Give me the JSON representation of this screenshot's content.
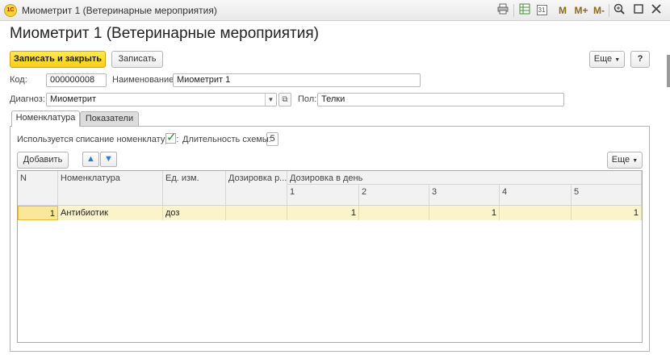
{
  "window": {
    "app_logo": "1С",
    "title": "Миометрит 1 (Ветеринарные мероприятия)",
    "toolbar_icons": [
      "print-icon",
      "spreadsheet-icon",
      "calendar-icon",
      "memory-store-icon",
      "memory-add-icon",
      "memory-subtract-icon",
      "zoom-icon",
      "maximize-icon",
      "close-icon"
    ],
    "calendar_glyph": "31",
    "mem_labels": [
      "M",
      "M+",
      "M-"
    ]
  },
  "header": {
    "title": "Миометрит 1 (Ветеринарные мероприятия)"
  },
  "commandbar": {
    "save_close_label": "Записать и закрыть",
    "save_label": "Записать",
    "more_label": "Еще",
    "help_label": "?"
  },
  "form": {
    "code_label": "Код:",
    "code_value": "000000008",
    "name_label": "Наименование:",
    "name_value": "Миометрит 1",
    "diagnosis_label": "Диагноз:",
    "diagnosis_value": "Миометрит",
    "sex_label": "Пол:",
    "sex_value": "Телки"
  },
  "tabs": [
    {
      "label": "Номенклатура",
      "active": true
    },
    {
      "label": "Показатели",
      "active": false
    }
  ],
  "nomenclature": {
    "uses_writeoff_label": "Используется списание номенклатуры:",
    "uses_writeoff_checked": true,
    "duration_label": "Длительность схемы:",
    "duration_value": "5",
    "add_label": "Добавить",
    "more_label": "Еще"
  },
  "table": {
    "headers": {
      "n": "N",
      "item": "Номенклатура",
      "unit": "Ед. изм.",
      "dosage": "Дозировка р...",
      "per_day": "Дозировка в день",
      "days": [
        "1",
        "2",
        "3",
        "4",
        "5"
      ]
    },
    "rows": [
      {
        "n": "1",
        "item": "Антибиотик",
        "unit": "доз",
        "dosage": "",
        "days": [
          "1",
          "",
          "1",
          "",
          "1"
        ]
      }
    ]
  },
  "colors": {
    "primary_button": "#f7cf14",
    "selected_row": "#fbf3c9",
    "checkbox_tick": "#2e8b2e"
  }
}
